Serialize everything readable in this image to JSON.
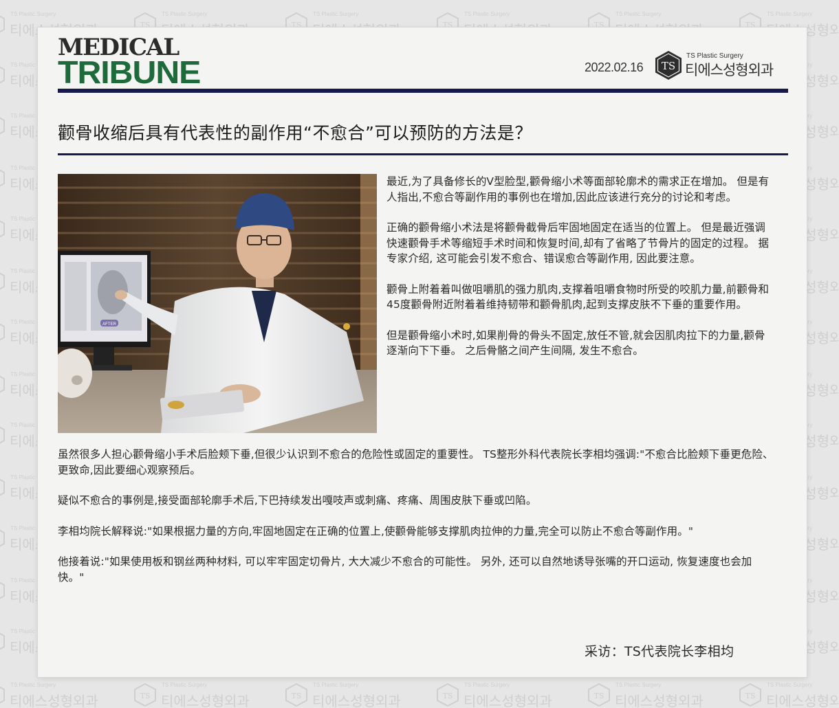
{
  "watermark": {
    "small": "TS Plastic Surgery",
    "logo_text": "TS",
    "name": "티에스성형외과"
  },
  "masthead": {
    "top": "MEDICAL",
    "bottom": "TRIBUNE"
  },
  "date": "2022.02.16",
  "brand": {
    "logo_text": "TS",
    "small": "TS Plastic Surgery",
    "name": "티에스성형외과"
  },
  "headline": "颧骨收缩后具有代表性的副作用“不愈合”可以预防的方法是？",
  "photo": {
    "monitor_button": "AFTER"
  },
  "side_paragraphs": [
    "最近,为了具备修长的V型脸型,颧骨缩小术等面部轮廓术的需求正在增加。 但是有人指出,不愈合等副作用的事例也在增加,因此应该进行充分的讨论和考虑。",
    "正确的颧骨缩小术法是将颧骨截骨后牢固地固定在适当的位置上。 但是最近强调快速颧骨手术等缩短手术时间和恢复时间,却有了省略了节骨片的固定的过程。 据专家介绍, 这可能会引发不愈合、错误愈合等副作用, 因此要注意。",
    "颧骨上附着着叫做咀嚼肌的强力肌肉,支撑着咀嚼食物时所受的咬肌力量,前颧骨和45度颧骨附近附着着维持韧带和颧骨肌肉,起到支撑皮肤不下垂的重要作用。",
    "但是颧骨缩小术时,如果削骨的骨头不固定,放任不管,就会因肌肉拉下的力量,颧骨逐渐向下下垂。 之后骨骼之间产生间隔, 发生不愈合。"
  ],
  "body_paragraphs": [
    "虽然很多人担心颧骨缩小手术后脸颊下垂,但很少认识到不愈合的危险性或固定的重要性。 TS整形外科代表院长李相均强调:\"不愈合比脸颊下垂更危险、更致命,因此要细心观察预后。",
    "疑似不愈合的事例是,接受面部轮廓手术后,下巴持续发出嘎吱声或刺痛、疼痛、周围皮肤下垂或凹陷。",
    "李相均院长解释说:\"如果根据力量的方向,牢固地固定在正确的位置上,使颧骨能够支撑肌肉拉伸的力量,完全可以防止不愈合等副作用。\"",
    "他接着说:\"如果使用板和钢丝两种材料, 可以牢牢固定切骨片, 大大减少不愈合的可能性。 另外, 还可以自然地诱导张嘴的开口运动, 恢复速度也会加快。\""
  ],
  "credit": "采访：TS代表院长李相均"
}
